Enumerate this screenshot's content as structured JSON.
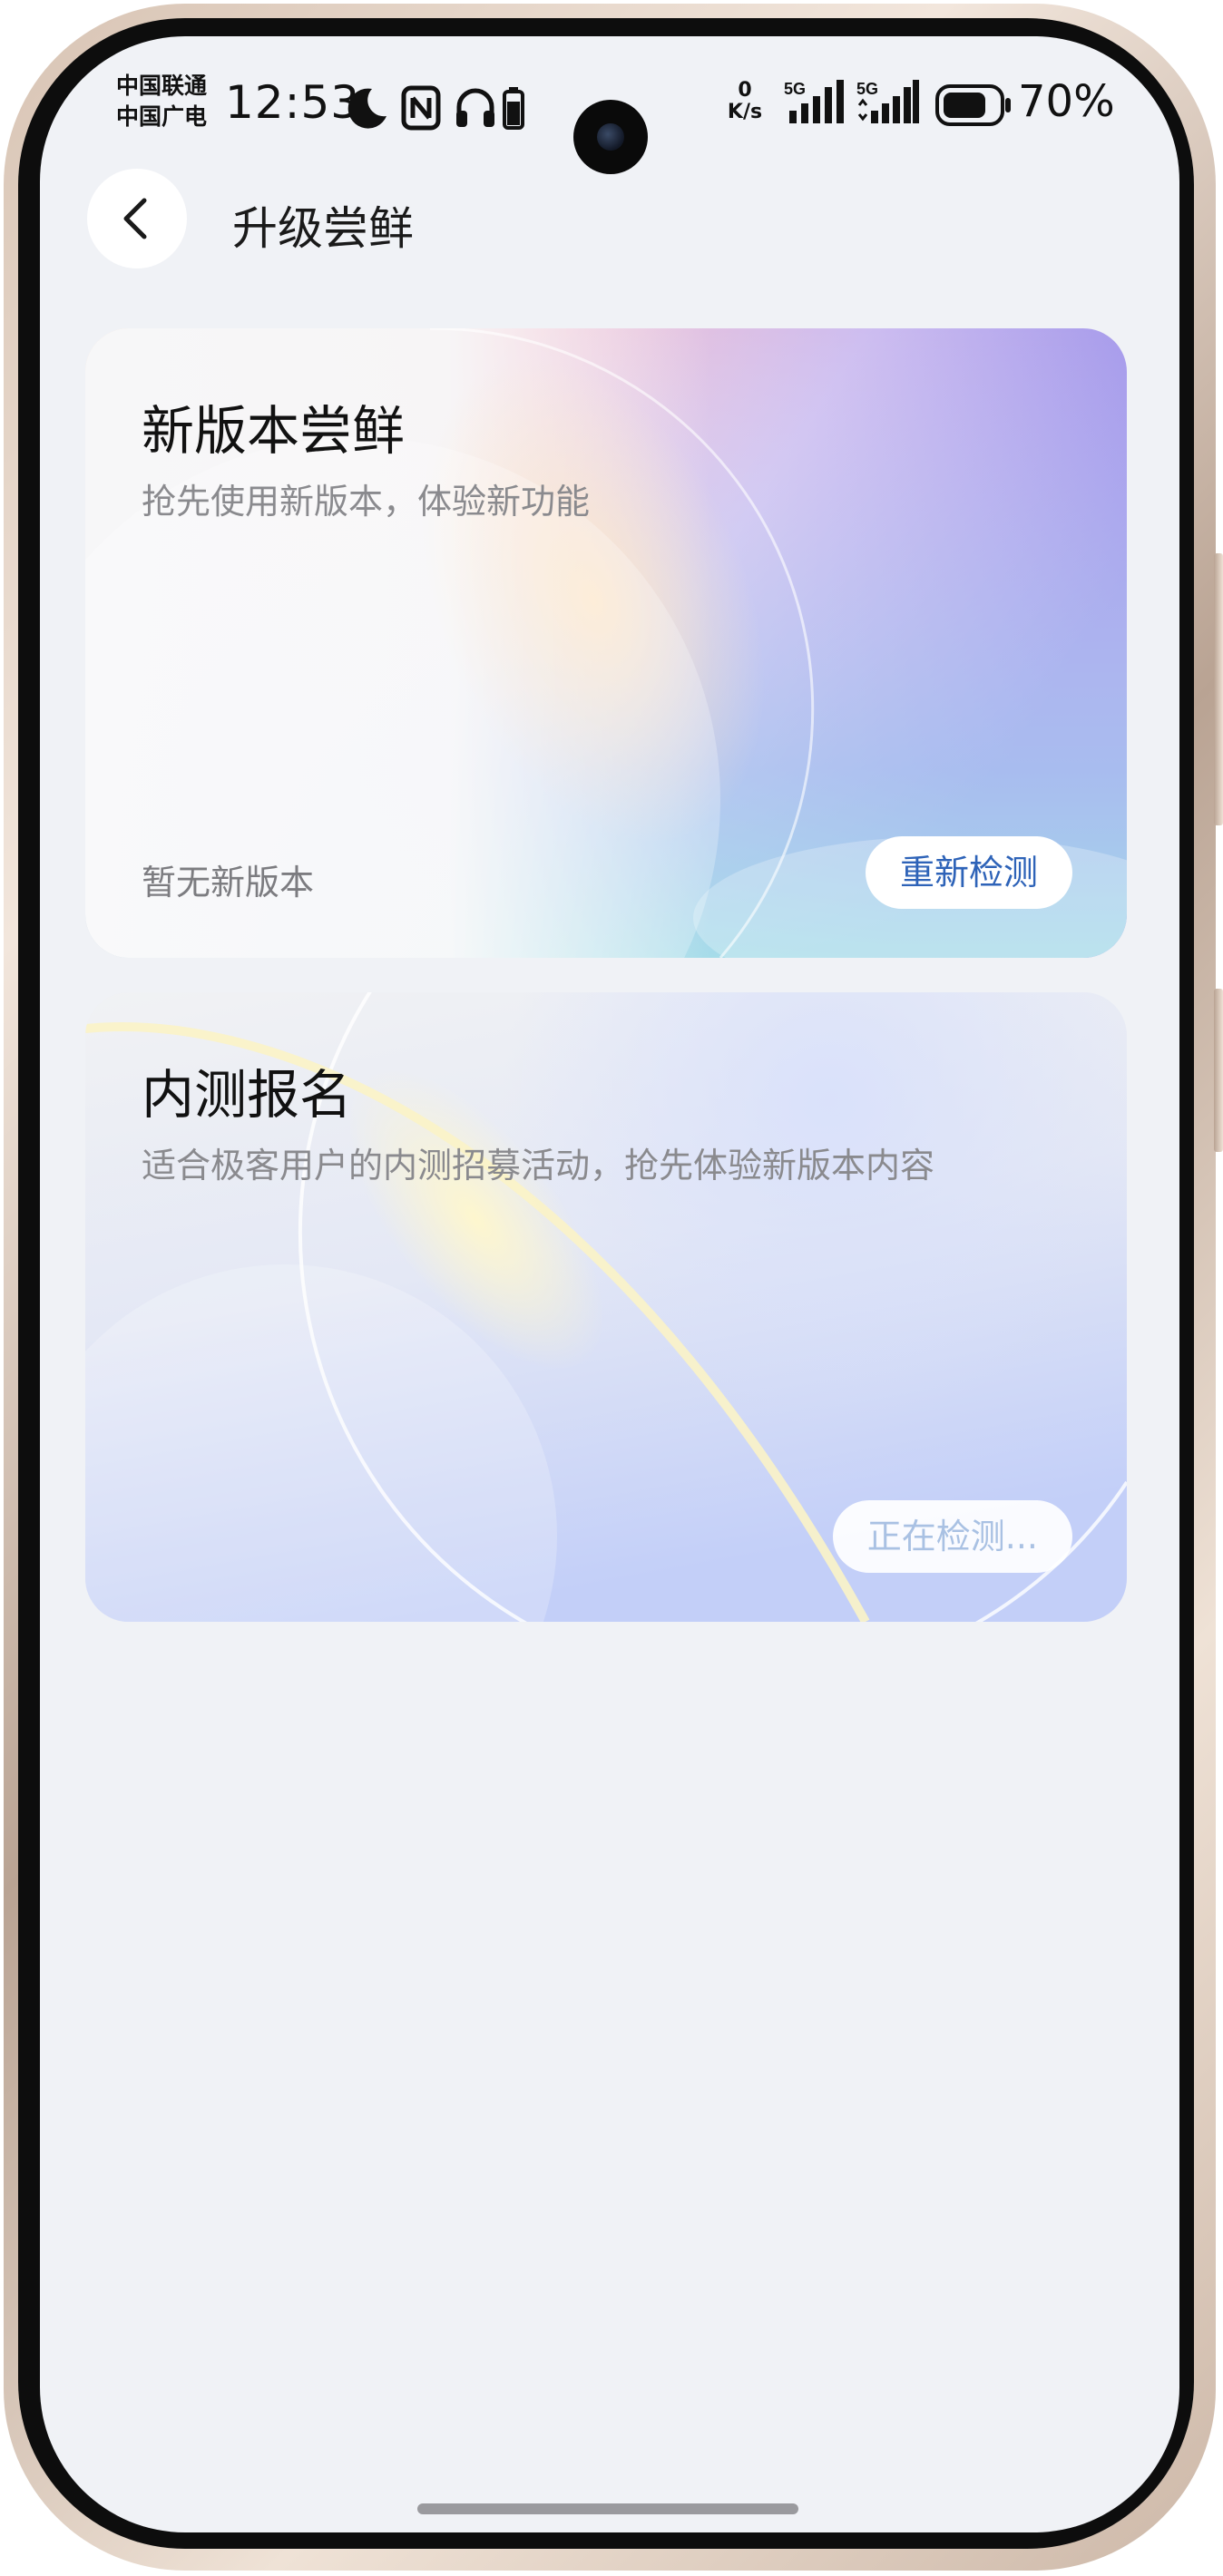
{
  "status_bar": {
    "carrier_line1": "中国联通",
    "carrier_line2": "中国广电",
    "time": "12:53",
    "net_speed_value": "0",
    "net_speed_unit": "K/s",
    "signal1_label": "5G",
    "signal2_label": "5G",
    "battery_percent": "70%",
    "icons": [
      "moon-icon",
      "nfc-icon",
      "headphones-icon",
      "small-battery-icon",
      "signal-5g-icon",
      "signal-5g-icon",
      "battery-icon"
    ]
  },
  "header": {
    "back_icon": "chevron-left-icon",
    "title": "升级尝鲜"
  },
  "cards": [
    {
      "title": "新版本尝鲜",
      "description": "抢先使用新版本，体验新功能",
      "status": "暂无新版本",
      "button_label": "重新检测",
      "button_color": "#2e63b8"
    },
    {
      "title": "内测报名",
      "description": "适合极客用户的内测招募活动，抢先体验新版本内容",
      "button_label": "正在检测...",
      "button_color": "#a9c1e3"
    }
  ],
  "colors": {
    "background": "#f0f2f6",
    "title_text": "#111111",
    "secondary_text": "#8a8a8e"
  }
}
